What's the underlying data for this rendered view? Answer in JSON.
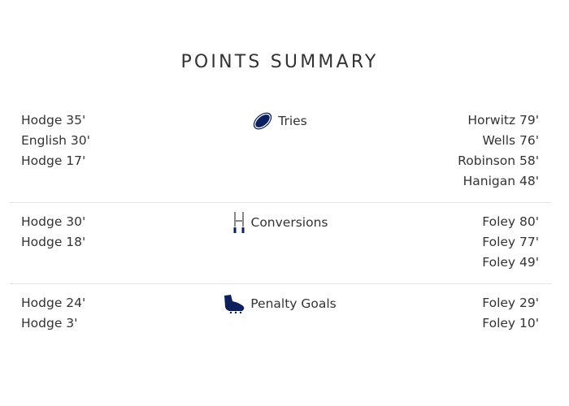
{
  "title": "POINTS SUMMARY",
  "colors": {
    "text": "#333333",
    "icon_navy": "#0d1f5c",
    "divider": "#e4e4e4"
  },
  "sections": [
    {
      "label": "Tries",
      "icon": "rugby-ball-icon",
      "left": [
        "Hodge 35'",
        "English 30'",
        "Hodge 17'"
      ],
      "right": [
        "Horwitz 79'",
        "Wells 76'",
        "Robinson 58'",
        "Hanigan 48'"
      ]
    },
    {
      "label": "Conversions",
      "icon": "goal-posts-icon",
      "left": [
        "Hodge 30'",
        "Hodge 18'"
      ],
      "right": [
        "Foley 80'",
        "Foley 77'",
        "Foley 49'"
      ]
    },
    {
      "label": "Penalty Goals",
      "icon": "boot-icon",
      "left": [
        "Hodge 24'",
        "Hodge 3'"
      ],
      "right": [
        "Foley 29'",
        "Foley 10'"
      ]
    }
  ]
}
